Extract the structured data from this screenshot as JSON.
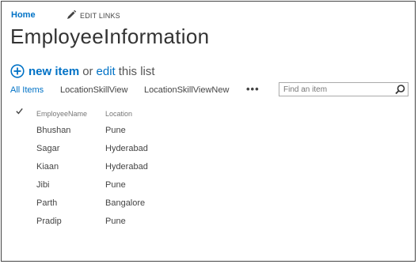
{
  "nav": {
    "home": "Home",
    "edit_links": "EDIT LINKS"
  },
  "page_title": "EmployeeInformation",
  "actions": {
    "new_item": "new item",
    "or": "or",
    "edit": "edit",
    "this_list": "this list"
  },
  "views": [
    "All Items",
    "LocationSkillView",
    "LocationSkillViewNew"
  ],
  "more_views": "•••",
  "search": {
    "placeholder": "Find an item",
    "value": ""
  },
  "table": {
    "columns": [
      "EmployeeName",
      "Location"
    ],
    "rows": [
      {
        "name": "Bhushan",
        "location": "Pune"
      },
      {
        "name": "Sagar",
        "location": "Hyderabad"
      },
      {
        "name": "Kiaan",
        "location": "Hyderabad"
      },
      {
        "name": "Jibi",
        "location": "Pune"
      },
      {
        "name": "Parth",
        "location": "Bangalore"
      },
      {
        "name": "Pradip",
        "location": "Pune"
      }
    ]
  },
  "colors": {
    "accent": "#0072c6",
    "text": "#444444",
    "border": "#444444"
  },
  "icons": {
    "edit": "pencil-icon",
    "new": "plus-circle-icon",
    "search": "magnifier-icon",
    "select": "checkmark-icon"
  }
}
